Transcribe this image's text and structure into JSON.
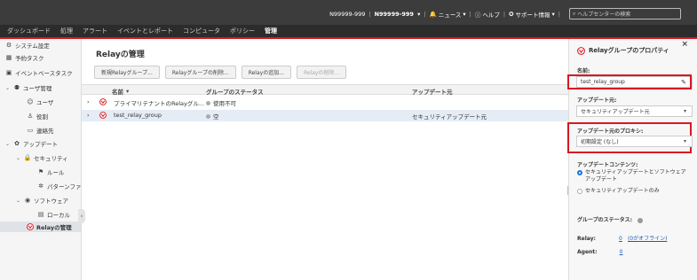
{
  "topbar": {
    "account": "N99999-999",
    "account2": "N99999-999",
    "news": "ニュース",
    "help": "ヘルプ",
    "support": "サポート情報",
    "search_placeholder": "ヘルプセンターの検索"
  },
  "nav": {
    "items": [
      "ダッシュボード",
      "処理",
      "アラート",
      "イベントとレポート",
      "コンピュータ",
      "ポリシー",
      "管理"
    ],
    "active_index": 6
  },
  "sidebar": {
    "items": [
      {
        "label": "システム設定",
        "icon": "gear-icon"
      },
      {
        "label": "予約タスク",
        "icon": "calendar-icon"
      },
      {
        "label": "イベントベースタスク",
        "icon": "event-task-icon"
      },
      {
        "label": "ユーザ管理",
        "icon": "user-admin-icon"
      },
      {
        "label": "ユーザ",
        "icon": "user-icon"
      },
      {
        "label": "役割",
        "icon": "role-icon"
      },
      {
        "label": "連絡先",
        "icon": "contact-icon"
      },
      {
        "label": "アップデート",
        "icon": "update-icon"
      },
      {
        "label": "セキュリティ",
        "icon": "lock-icon"
      },
      {
        "label": "ルール",
        "icon": "flag-icon"
      },
      {
        "label": "パターンファ",
        "icon": "pattern-icon"
      },
      {
        "label": "ソフトウェア",
        "icon": "software-icon"
      },
      {
        "label": "ローカル",
        "icon": "local-icon"
      },
      {
        "label": "Relayの管理",
        "icon": "relay-icon"
      }
    ]
  },
  "main": {
    "title": "Relayの管理",
    "toolbar": {
      "new_group": "新規Relayグループ...",
      "delete_group": "Relayグループの削除...",
      "add_relay": "Relayの追加...",
      "delete_relay": "Relayの削除..."
    },
    "columns": {
      "name": "名前",
      "group_status": "グループのステータス",
      "update_source": "アップデート元"
    },
    "rows": [
      {
        "name": "プライマリテナントのRelayグル...",
        "status": "使用不可",
        "source": ""
      },
      {
        "name": "test_relay_group",
        "status": "空",
        "source": "セキュリティアップデート元"
      }
    ]
  },
  "panel": {
    "title": "Relayグループのプロパティ",
    "name_label": "名前:",
    "name_value": "test_relay_group",
    "update_source_label": "アップデート元:",
    "update_source_value": "セキュリティアップデート元",
    "proxy_label": "アップデート元のプロキシ:",
    "proxy_value": "初期設定 (なし)",
    "content_label": "アップデートコンテンツ:",
    "content_option1": "セキュリティアップデートとソフトウェアアップデート",
    "content_option2": "セキュリティアップデートのみ",
    "group_status_label": "グループのステータス:",
    "relay_label": "Relay:",
    "relay_count": "0",
    "relay_offline": "(0がオフライン)",
    "agent_label": "Agent:",
    "agent_count": "0"
  },
  "colors": {
    "accent_red": "#d71920",
    "link_blue": "#1a5fb4",
    "selected_row": "#e5ecf5"
  }
}
